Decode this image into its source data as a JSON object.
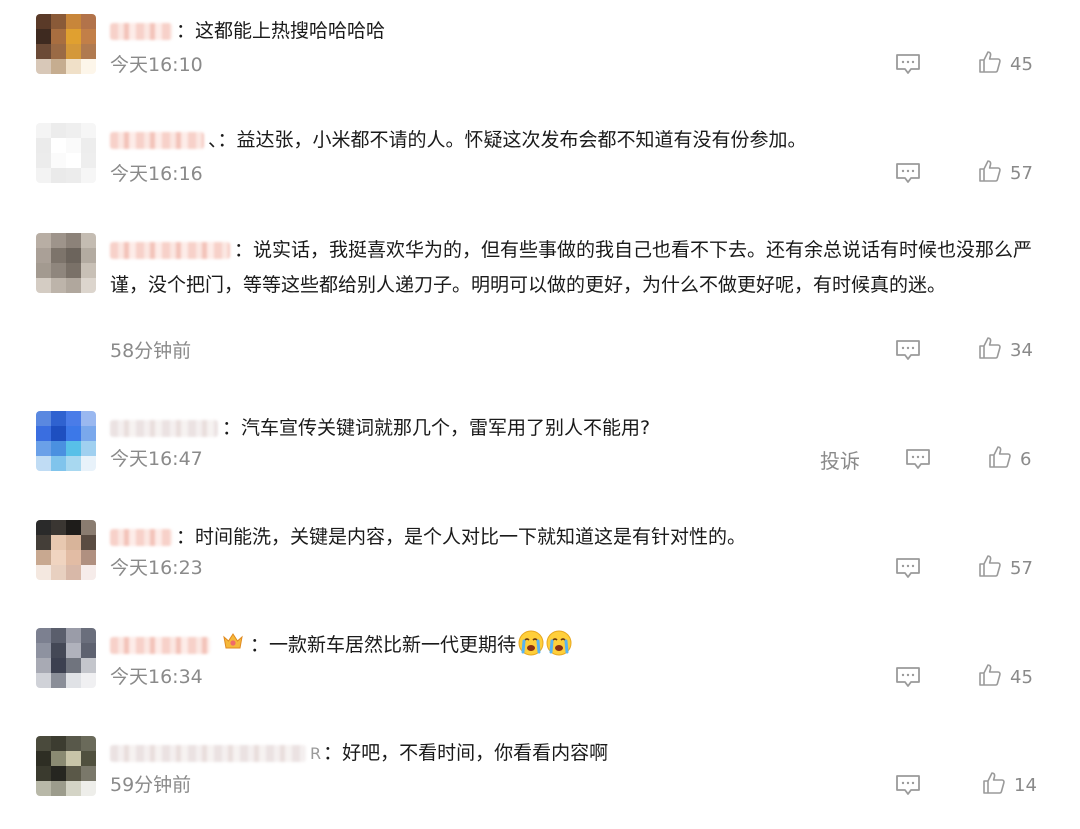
{
  "comments": [
    {
      "separator": "：",
      "text": "这都能上热搜哈哈哈哈",
      "time": "今天16:10",
      "likes": "45",
      "avatar_colors": [
        "#5a3a28",
        "#8a5a38",
        "#c8863a",
        "#b2734a",
        "#3e2a20",
        "#a86e40",
        "#e0a030",
        "#c27f48",
        "#6b4a36",
        "#9a6a45",
        "#d4983a",
        "#b07a50",
        "#d8c8b8",
        "#c6ad90",
        "#f0e0c8",
        "#fdf6ea"
      ]
    },
    {
      "separator": "、：",
      "text": "益达张，小米都不请的人。怀疑这次发布会都不知道有没有份参加。",
      "time": "今天16:16",
      "likes": "57",
      "avatar_colors": [
        "#f4f4f4",
        "#ececec",
        "#efefef",
        "#f6f6f6",
        "#ebebeb",
        "#ffffff",
        "#fafafa",
        "#ededed",
        "#ececec",
        "#fbfbfb",
        "#ffffff",
        "#eeeeee",
        "#f3f3f3",
        "#eaeaea",
        "#ececec",
        "#f6f6f6"
      ]
    },
    {
      "separator": "：",
      "text": "说实话，我挺喜欢华为的，但有些事做的我自己也看不下去。还有余总说话有时候也没那么严谨，没个把门，等等这些都给别人递刀子。明明可以做的更好，为什么不做更好呢，有时候真的迷。",
      "time": "58分钟前",
      "likes": "34",
      "avatar_colors": [
        "#b8aea4",
        "#9e948b",
        "#8c8279",
        "#c4bcb2",
        "#aaa097",
        "#7d746b",
        "#6c645c",
        "#b3aba1",
        "#a39a90",
        "#8f867d",
        "#7a7168",
        "#c8c0b6",
        "#d4ccc3",
        "#bdb4aa",
        "#b0a79d",
        "#dcd5cd"
      ]
    },
    {
      "separator": "：",
      "text": "汽车宣传关键词就那几个，雷军用了别人不能用?",
      "time": "今天16:47",
      "likes": "6",
      "report_label": "投诉",
      "avatar_colors": [
        "#5a88e0",
        "#2f62d0",
        "#4a7ce8",
        "#9ab8f0",
        "#3a6ee0",
        "#1e4fc0",
        "#3c78e8",
        "#7aa8ec",
        "#6aa0e8",
        "#4a90e0",
        "#58c0e8",
        "#a0d0f0",
        "#c0dcf4",
        "#80c4ec",
        "#a8d8f0",
        "#e8f2fa"
      ]
    },
    {
      "separator": "：",
      "text": "时间能洗，关键是内容，是个人对比一下就知道这是有针对性的。",
      "time": "今天16:23",
      "likes": "57",
      "avatar_colors": [
        "#2a2a2a",
        "#3a3632",
        "#1e1c1a",
        "#8a7c70",
        "#443e38",
        "#e8c8b0",
        "#d8b49a",
        "#5a4c42",
        "#c8a890",
        "#f0d4c0",
        "#e2bca4",
        "#b09080",
        "#f4e8e0",
        "#e8d0c0",
        "#d8b8a8",
        "#f6ecea"
      ]
    },
    {
      "separator": "：",
      "text": "一款新车居然比新一代更期待",
      "time": "今天16:34",
      "likes": "45",
      "has_crown": true,
      "emoji": "crying-emoji",
      "avatar_colors": [
        "#7c8090",
        "#5a5e6c",
        "#9a9ca8",
        "#6a6e7c",
        "#8e92a0",
        "#444856",
        "#b0b2bc",
        "#5e6270",
        "#a8aab4",
        "#3c4050",
        "#70747e",
        "#c4c6cc",
        "#d0d2d8",
        "#8a8e98",
        "#e0e2e6",
        "#f0f0f2"
      ]
    },
    {
      "separator": "：",
      "name_tail": "R",
      "text": "好吧，不看时间，你看看内容啊",
      "time": "59分钟前",
      "likes": "14",
      "avatar_colors": [
        "#4a4a3c",
        "#3c3c30",
        "#58584a",
        "#6a6a5a",
        "#2e2e24",
        "#8a8a72",
        "#c8c4a8",
        "#50503e",
        "#3a3a2e",
        "#262620",
        "#5a5848",
        "#7a786a",
        "#b8b8a8",
        "#9c9c8c",
        "#d4d4c6",
        "#eeeeea"
      ]
    }
  ]
}
